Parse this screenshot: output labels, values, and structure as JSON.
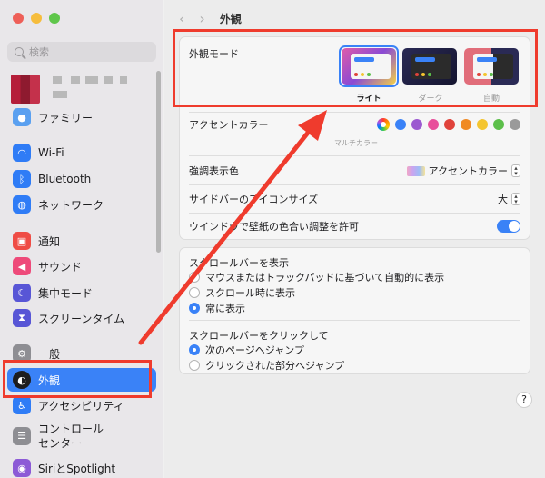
{
  "window": {
    "title": "外観"
  },
  "sidebar": {
    "search_placeholder": "検索",
    "items": [
      {
        "label": "ファミリー",
        "icon": "family-icon",
        "color": "#5aa0f0"
      },
      {
        "label": "Wi-Fi",
        "icon": "wifi-icon",
        "color": "#2f7cf6"
      },
      {
        "label": "Bluetooth",
        "icon": "bluetooth-icon",
        "color": "#2f7cf6"
      },
      {
        "label": "ネットワーク",
        "icon": "globe-icon",
        "color": "#2f7cf6"
      },
      {
        "label": "通知",
        "icon": "bell-icon",
        "color": "#ef4c45"
      },
      {
        "label": "サウンド",
        "icon": "speaker-icon",
        "color": "#ee4a7a"
      },
      {
        "label": "集中モード",
        "icon": "moon-icon",
        "color": "#5856d6"
      },
      {
        "label": "スクリーンタイム",
        "icon": "hourglass-icon",
        "color": "#5856d6"
      },
      {
        "label": "一般",
        "icon": "gear-icon",
        "color": "#8e8e93"
      },
      {
        "label": "外観",
        "icon": "appearance-icon",
        "color": "#1d1d1f"
      },
      {
        "label": "アクセシビリティ",
        "icon": "accessibility-icon",
        "color": "#2f7cf6"
      },
      {
        "label": "コントロール\nセンター",
        "icon": "control-center-icon",
        "color": "#8e8e93"
      },
      {
        "label": "SiriとSpotlight",
        "icon": "siri-icon",
        "color": "#8c5ad6"
      }
    ]
  },
  "appearance": {
    "label": "外観モード",
    "modes": [
      {
        "label": "ライト",
        "selected": true
      },
      {
        "label": "ダーク",
        "selected": false
      },
      {
        "label": "自動",
        "selected": false
      }
    ]
  },
  "accent": {
    "label": "アクセントカラー",
    "sublabel": "マルチカラー",
    "colors": [
      "#3a82f7",
      "#9b59d0",
      "#e84f9b",
      "#e0433b",
      "#f08a24",
      "#f4c52f",
      "#5cbf4a",
      "#9a9a9a"
    ]
  },
  "highlight": {
    "label": "強調表示色",
    "value": "アクセントカラー"
  },
  "sidebar_icon_size": {
    "label": "サイドバーのアイコンサイズ",
    "value": "大"
  },
  "wallpaper_tint": {
    "label": "ウインドウで壁紙の色合い調整を許可",
    "enabled": true
  },
  "scrollbars": {
    "show_label": "スクロールバーを表示",
    "show_options": [
      {
        "label": "マウスまたはトラックパッドに基づいて自動的に表示",
        "selected": false
      },
      {
        "label": "スクロール時に表示",
        "selected": false
      },
      {
        "label": "常に表示",
        "selected": true
      }
    ],
    "click_label": "スクロールバーをクリックして",
    "click_options": [
      {
        "label": "次のページへジャンプ",
        "selected": true
      },
      {
        "label": "クリックされた部分へジャンプ",
        "selected": false
      }
    ]
  },
  "help": "?",
  "annotation_color": "#ef3b2d"
}
